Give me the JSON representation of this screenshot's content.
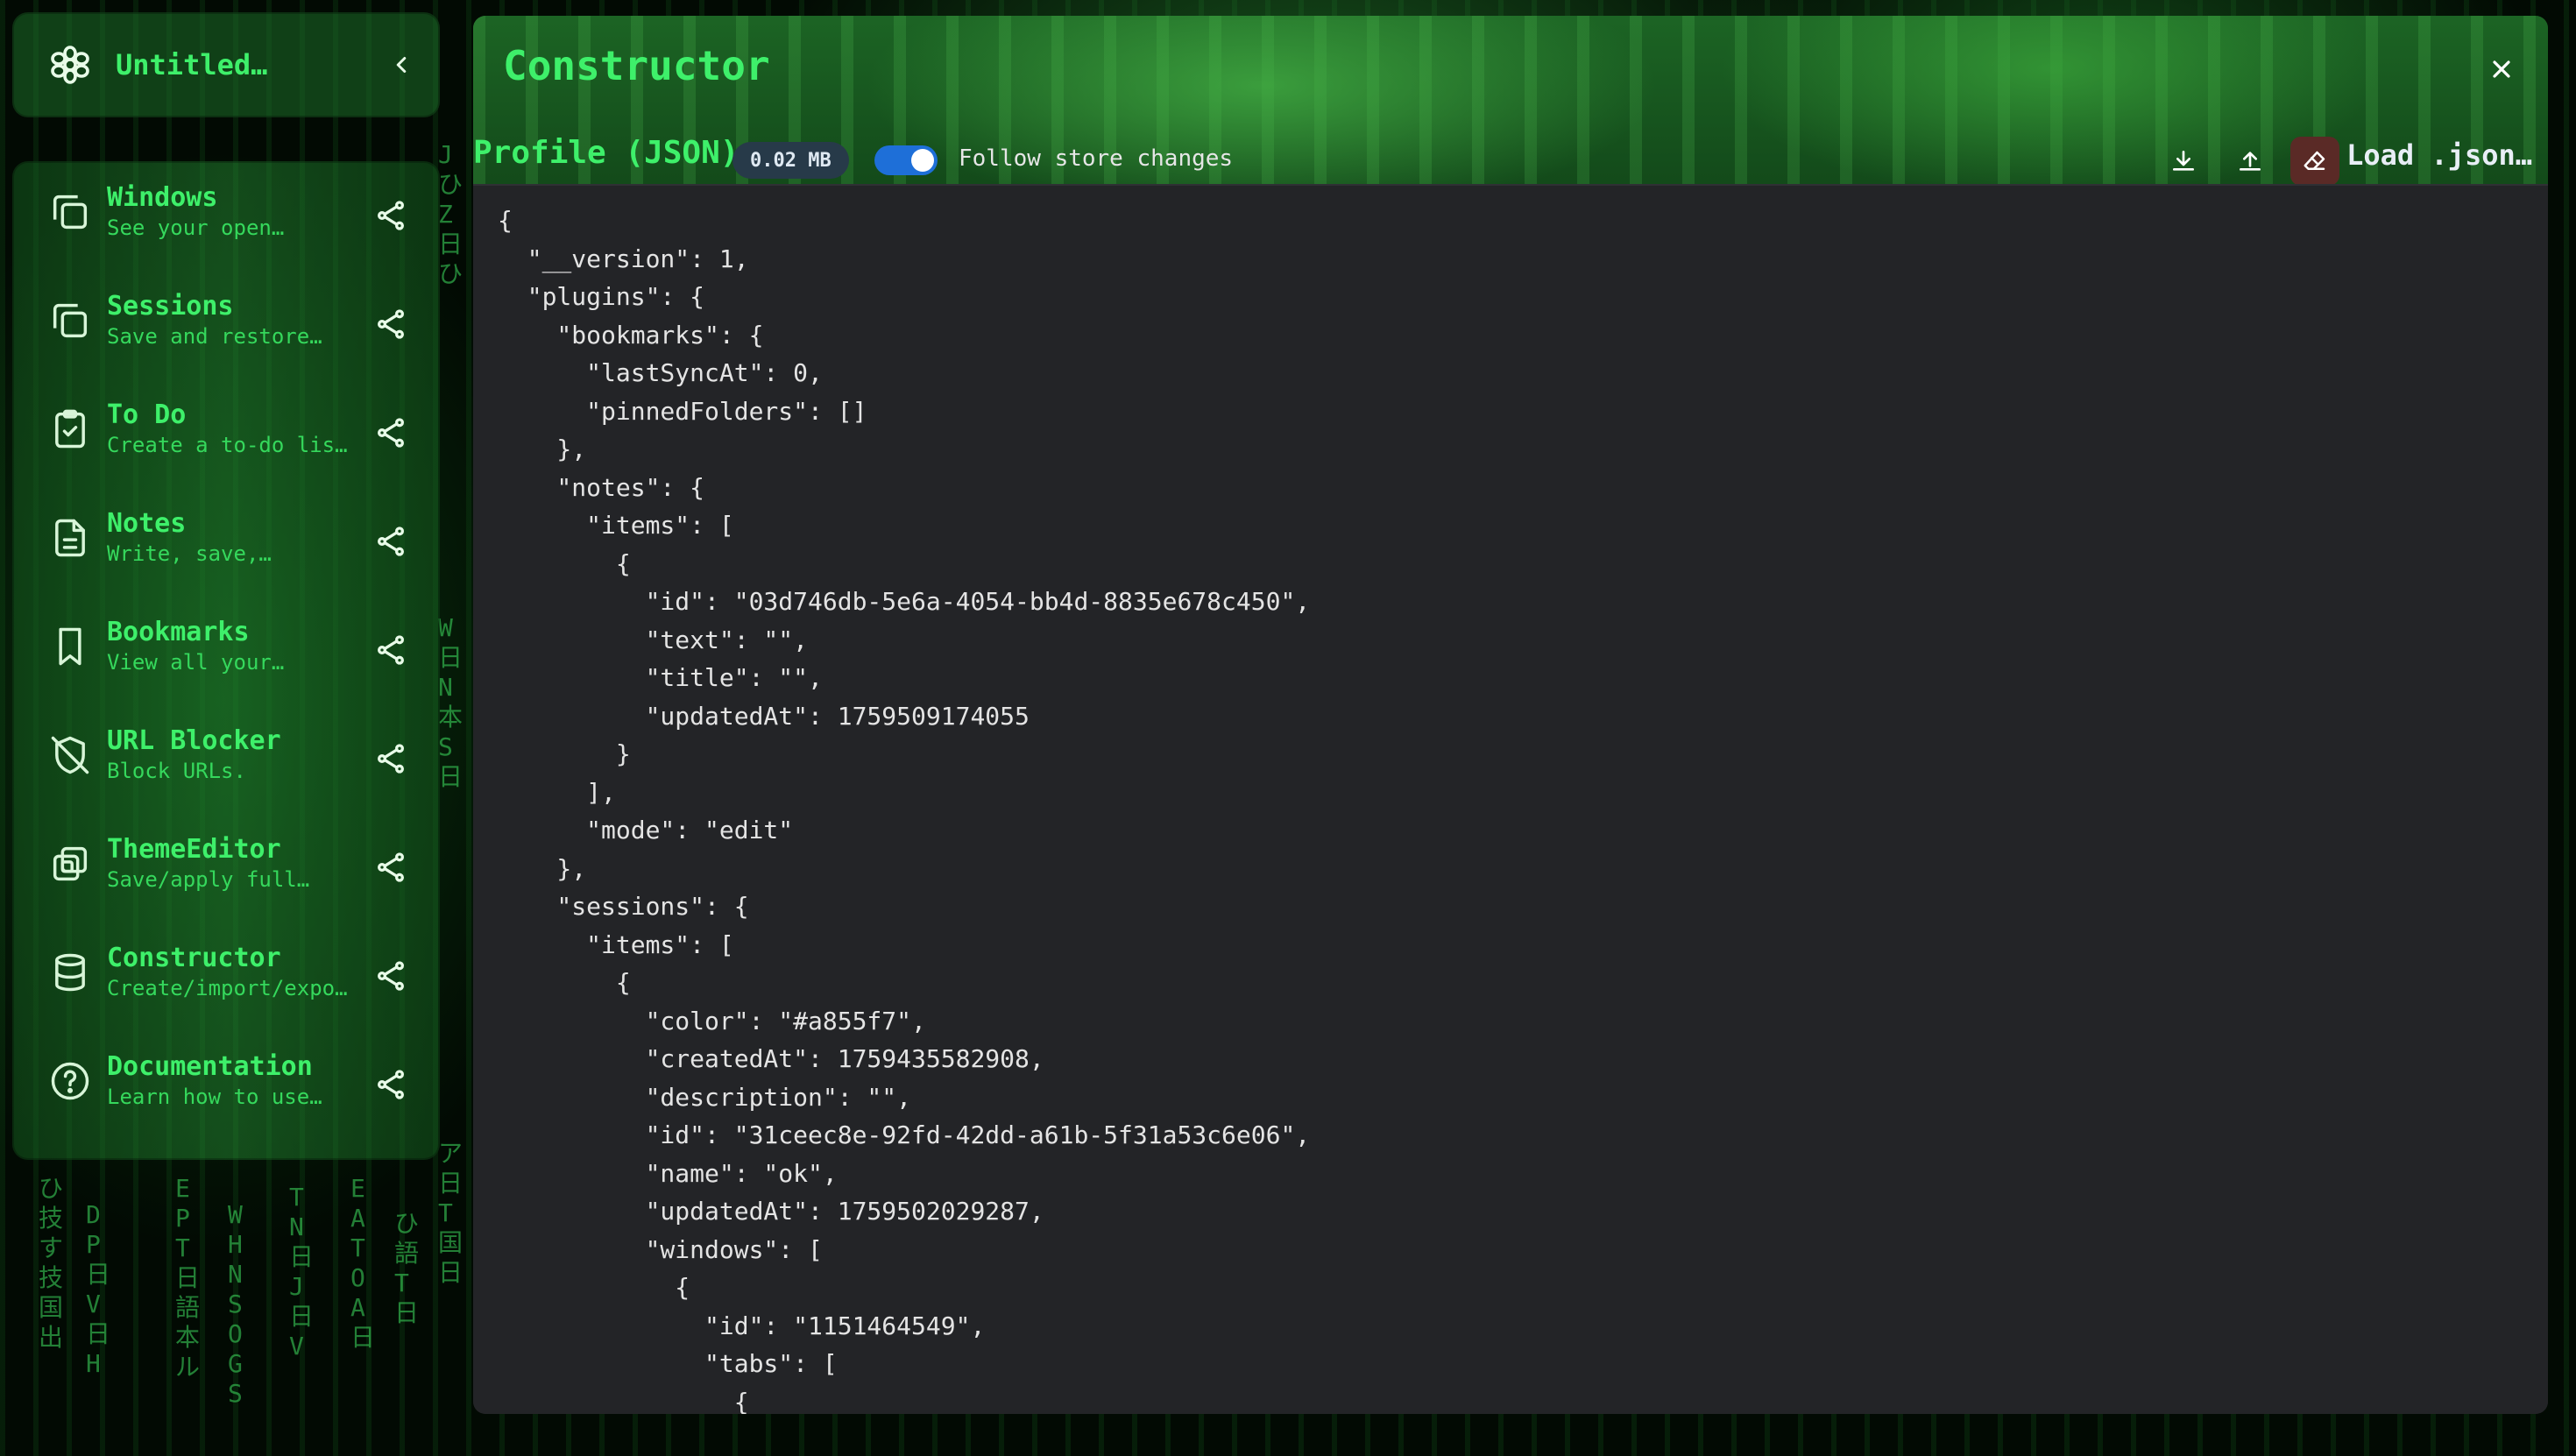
{
  "background": {
    "columns": [
      "ひ技す技国出",
      "DP日V日H",
      "EPT日語本ル",
      "WHNSOGS",
      "TN日J日V",
      "EATOA日",
      "ひ語T日",
      "JひZ日ひ",
      "W日N本S日",
      "ア日T国日"
    ]
  },
  "sidebar": {
    "header": {
      "title": "Untitled…"
    },
    "items": [
      {
        "name": "Windows",
        "desc": "See your open…",
        "icon": "windows-icon"
      },
      {
        "name": "Sessions",
        "desc": "Save and restore…",
        "icon": "sessions-icon"
      },
      {
        "name": "To Do",
        "desc": "Create a to-do lis…",
        "icon": "clipboard-check-icon"
      },
      {
        "name": "Notes",
        "desc": "Write, save,…",
        "icon": "file-text-icon"
      },
      {
        "name": "Bookmarks",
        "desc": "View all your…",
        "icon": "bookmark-icon"
      },
      {
        "name": "URL Blocker",
        "desc": "Block URLs.",
        "icon": "shield-off-icon"
      },
      {
        "name": "ThemeEditor",
        "desc": "Save/apply full…",
        "icon": "theme-copy-icon"
      },
      {
        "name": "Constructor",
        "desc": "Create/import/expo…",
        "icon": "database-icon"
      },
      {
        "name": "Documentation",
        "desc": "Learn how to use…",
        "icon": "help-circle-icon"
      }
    ]
  },
  "window": {
    "title": "Constructor",
    "toolbar": {
      "profile_label": "Profile (JSON)",
      "size": "0.02 MB",
      "follow_label": "Follow store changes",
      "follow_enabled": true,
      "load_label": "Load .json…"
    },
    "json_text": "{\n  \"__version\": 1,\n  \"plugins\": {\n    \"bookmarks\": {\n      \"lastSyncAt\": 0,\n      \"pinnedFolders\": []\n    },\n    \"notes\": {\n      \"items\": [\n        {\n          \"id\": \"03d746db-5e6a-4054-bb4d-8835e678c450\",\n          \"text\": \"\",\n          \"title\": \"\",\n          \"updatedAt\": 1759509174055\n        }\n      ],\n      \"mode\": \"edit\"\n    },\n    \"sessions\": {\n      \"items\": [\n        {\n          \"color\": \"#a855f7\",\n          \"createdAt\": 1759435582908,\n          \"description\": \"\",\n          \"id\": \"31ceec8e-92fd-42dd-a61b-5f31a53c6e06\",\n          \"name\": \"ok\",\n          \"updatedAt\": 1759502029287,\n          \"windows\": [\n            {\n              \"id\": \"1151464549\",\n              \"tabs\": [\n                {"
  },
  "colors": {
    "accent_green": "#3ef06a",
    "toggle_blue": "#1e6fd8",
    "editor_bg": "#232427",
    "danger_bg": "#5a2a26"
  }
}
